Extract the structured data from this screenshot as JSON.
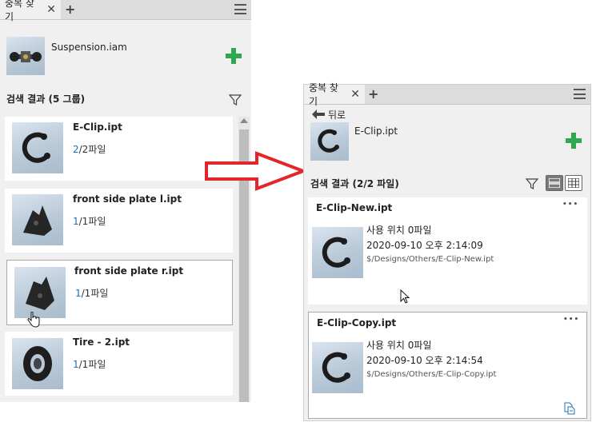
{
  "left_panel": {
    "tab_label": "중복 찾기",
    "assembly_name": "Suspension.iam",
    "results_title": "검색 결과 (5 그룹)",
    "items": [
      {
        "name": "E-Clip.ipt",
        "count_current": "2",
        "count_rest": "/2파일",
        "icon": "e-clip-icon"
      },
      {
        "name": "front side plate l.ipt",
        "count_current": "1",
        "count_rest": "/1파일",
        "icon": "plate-icon"
      },
      {
        "name": "front side plate r.ipt",
        "count_current": "1",
        "count_rest": "/1파일",
        "icon": "plate-icon"
      },
      {
        "name": "Tire - 2.ipt",
        "count_current": "1",
        "count_rest": "/1파일",
        "icon": "tire-icon"
      }
    ]
  },
  "right_panel": {
    "tab_label": "중복 찾기",
    "back_label": "뒤로",
    "part_name": "E-Clip.ipt",
    "results_title": "검색 결과 (2/2 파일)",
    "results": [
      {
        "name": "E-Clip-New.ipt",
        "usage": "사용 위치 0파일",
        "date": "2020-09-10 오후 2:14:09",
        "path": "$/Designs/Others/E-Clip-New.ipt",
        "menu": "•••"
      },
      {
        "name": "E-Clip-Copy.ipt",
        "usage": "사용 위치 0파일",
        "date": "2020-09-10 오후 2:14:54",
        "path": "$/Designs/Others/E-Clip-Copy.ipt",
        "menu": "•••"
      }
    ]
  },
  "colors": {
    "accent_green": "#2fa84f",
    "link_blue": "#1f6fb2",
    "arrow_red": "#e2262b"
  }
}
